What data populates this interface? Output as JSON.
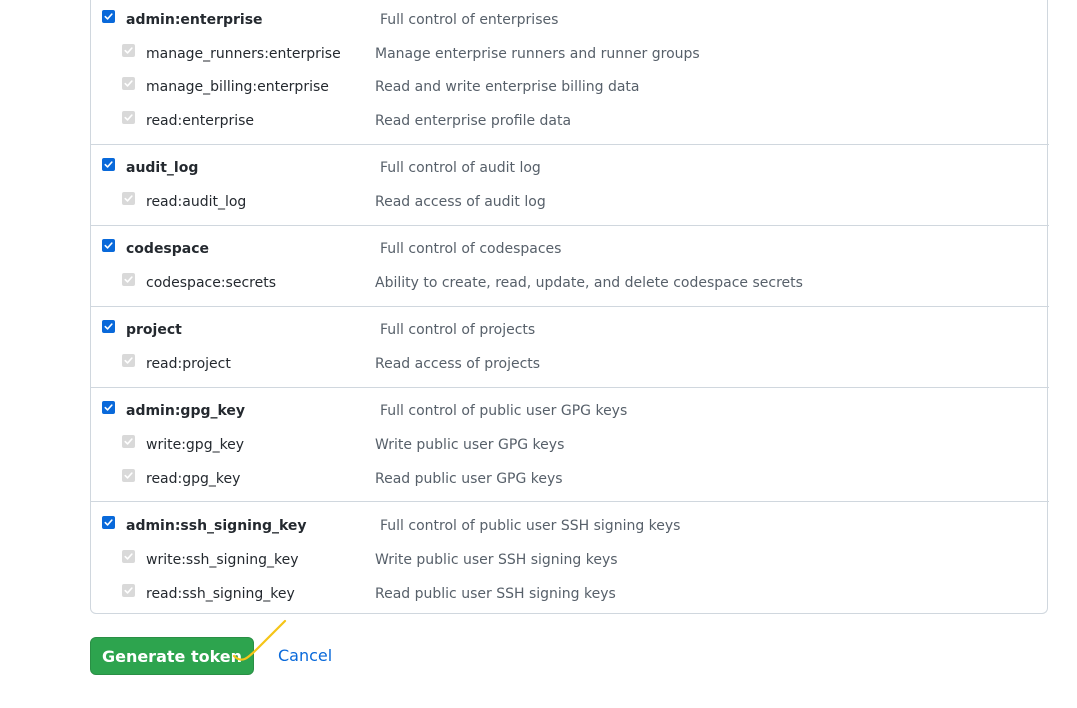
{
  "scope_groups": [
    {
      "parent": {
        "label": "admin:enterprise",
        "description": "Full control of enterprises",
        "checked": true
      },
      "children": [
        {
          "label": "manage_runners:enterprise",
          "description": "Manage enterprise runners and runner groups",
          "checked": true
        },
        {
          "label": "manage_billing:enterprise",
          "description": "Read and write enterprise billing data",
          "checked": true
        },
        {
          "label": "read:enterprise",
          "description": "Read enterprise profile data",
          "checked": true
        }
      ]
    },
    {
      "parent": {
        "label": "audit_log",
        "description": "Full control of audit log",
        "checked": true
      },
      "children": [
        {
          "label": "read:audit_log",
          "description": "Read access of audit log",
          "checked": true
        }
      ]
    },
    {
      "parent": {
        "label": "codespace",
        "description": "Full control of codespaces",
        "checked": true
      },
      "children": [
        {
          "label": "codespace:secrets",
          "description": "Ability to create, read, update, and delete codespace secrets",
          "checked": true
        }
      ]
    },
    {
      "parent": {
        "label": "project",
        "description": "Full control of projects",
        "checked": true
      },
      "children": [
        {
          "label": "read:project",
          "description": "Read access of projects",
          "checked": true
        }
      ]
    },
    {
      "parent": {
        "label": "admin:gpg_key",
        "description": "Full control of public user GPG keys",
        "checked": true
      },
      "children": [
        {
          "label": "write:gpg_key",
          "description": "Write public user GPG keys",
          "checked": true
        },
        {
          "label": "read:gpg_key",
          "description": "Read public user GPG keys",
          "checked": true
        }
      ]
    },
    {
      "parent": {
        "label": "admin:ssh_signing_key",
        "description": "Full control of public user SSH signing keys",
        "checked": true
      },
      "children": [
        {
          "label": "write:ssh_signing_key",
          "description": "Write public user SSH signing keys",
          "checked": true
        },
        {
          "label": "read:ssh_signing_key",
          "description": "Read public user SSH signing keys",
          "checked": true
        }
      ]
    }
  ],
  "actions": {
    "generate_label": "Generate token",
    "cancel_label": "Cancel"
  },
  "colors": {
    "primary_button": "#2da44e",
    "link": "#0969da",
    "checkbox_checked": "#0969da",
    "checkbox_disabled": "#d9d9d9",
    "annotation": "#f5c518"
  },
  "icons": {
    "checkbox": "checkmark-icon",
    "annotation": "highlight-stroke"
  }
}
